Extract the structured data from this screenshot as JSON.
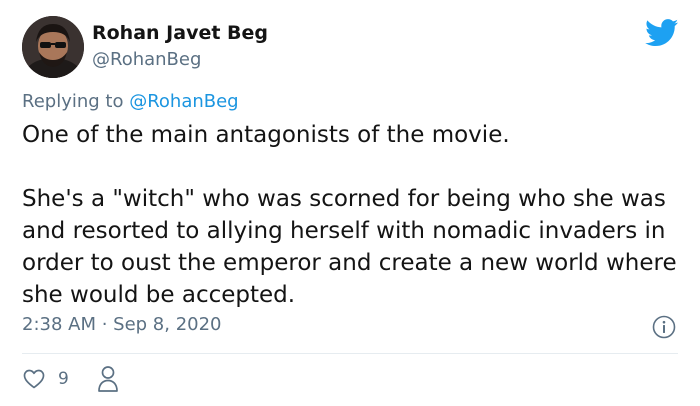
{
  "tweet": {
    "author": {
      "display_name": "Rohan Javet Beg",
      "handle": "@RohanBeg"
    },
    "replying_prefix": "Replying to ",
    "replying_to": "@RohanBeg",
    "text": "One of the main antagonists of the movie.\n\nShe's a \"witch\" who was scorned for being who she was and resorted to allying herself with nomadic invaders in order to oust the emperor and create a new world where she would be accepted.",
    "timestamp": "2:38 AM · Sep 8, 2020",
    "like_count": "9"
  },
  "icons": {
    "brand": "twitter-bird-icon",
    "info": "info-icon",
    "like": "heart-icon",
    "share": "person-icon"
  },
  "colors": {
    "brand_blue": "#1da1f2",
    "link_blue": "#1b95e0",
    "secondary_text": "#5b7083",
    "primary_text": "#141414",
    "divider": "#e6ecf0"
  }
}
